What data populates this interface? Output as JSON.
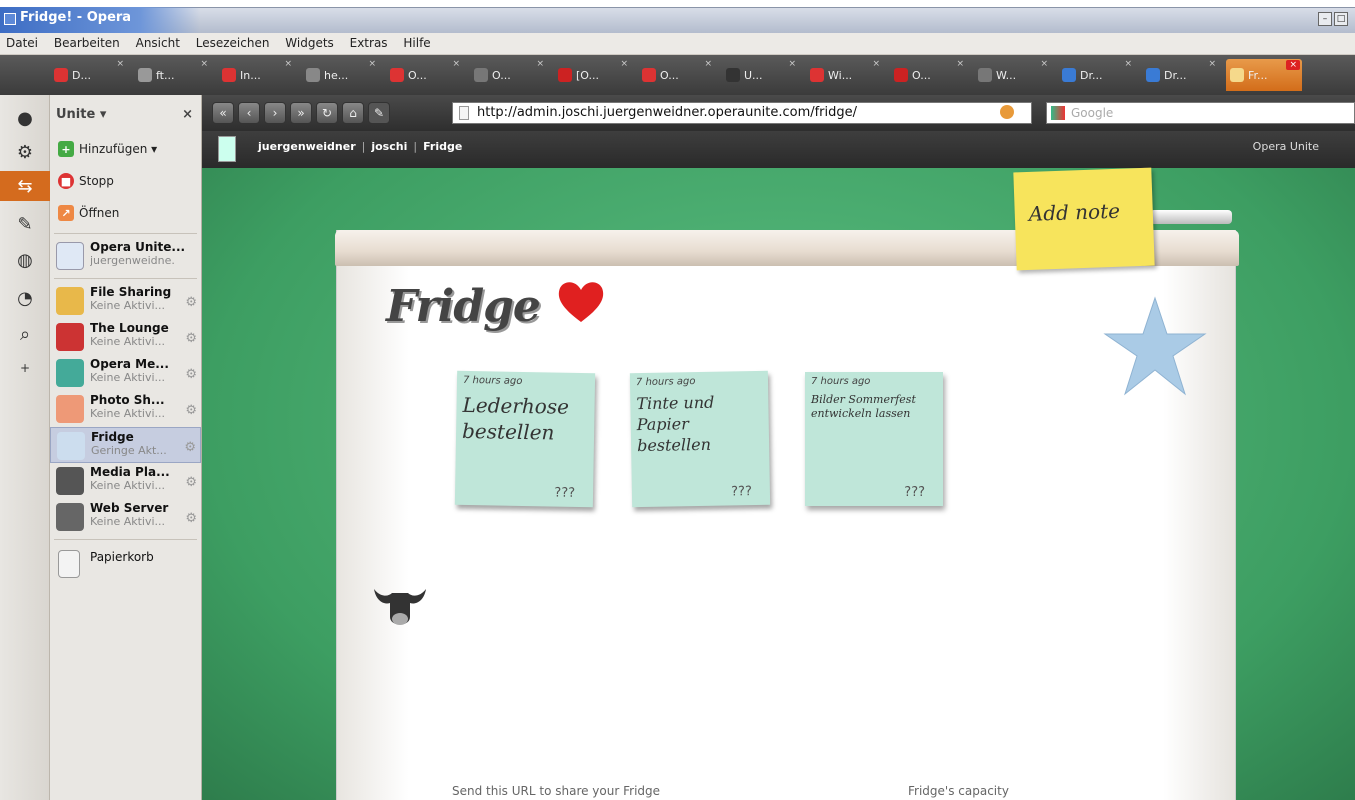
{
  "window": {
    "title": "Fridge! - Opera"
  },
  "menu": [
    "Datei",
    "Bearbeiten",
    "Ansicht",
    "Lesezeichen",
    "Widgets",
    "Extras",
    "Hilfe"
  ],
  "tabs": [
    {
      "label": "D...",
      "color": "#d33"
    },
    {
      "label": "ft...",
      "color": "#999"
    },
    {
      "label": "In...",
      "color": "#d33"
    },
    {
      "label": "he...",
      "color": "#888"
    },
    {
      "label": "O...",
      "color": "#d33"
    },
    {
      "label": "O...",
      "color": "#777"
    },
    {
      "label": "[O...",
      "color": "#c22"
    },
    {
      "label": "O...",
      "color": "#d33"
    },
    {
      "label": "U...",
      "color": "#333"
    },
    {
      "label": "Wi...",
      "color": "#d33"
    },
    {
      "label": "O...",
      "color": "#c22"
    },
    {
      "label": "W...",
      "color": "#777"
    },
    {
      "label": "Dr...",
      "color": "#3a7bd5"
    },
    {
      "label": "Dr...",
      "color": "#3a7bd5"
    },
    {
      "label": "Fr...",
      "color": "#f5d98b",
      "active": true
    }
  ],
  "panel": {
    "title": "Unite ▾",
    "close": "×",
    "actions": [
      {
        "label": "Hinzufügen ▾",
        "color": "#4a4"
      },
      {
        "label": "Stopp",
        "color": "#d33"
      },
      {
        "label": "Öffnen",
        "color": "#e84"
      }
    ],
    "home": {
      "name": "Opera Unite...",
      "status": "juergenweidne..."
    },
    "services": [
      {
        "name": "File Sharing",
        "status": "Keine Aktivi...",
        "color": "#e8b84a"
      },
      {
        "name": "The Lounge",
        "status": "Keine Aktivi...",
        "color": "#c33"
      },
      {
        "name": "Opera Me...",
        "status": "Keine Aktivi...",
        "color": "#4a9"
      },
      {
        "name": "Photo Sh...",
        "status": "Keine Aktivi...",
        "color": "#e97"
      },
      {
        "name": "Fridge",
        "status": "Geringe Akt...",
        "color": "#cde",
        "selected": true
      },
      {
        "name": "Media Pla...",
        "status": "Keine Aktivi...",
        "color": "#555"
      },
      {
        "name": "Web Server",
        "status": "Keine Aktivi...",
        "color": "#666"
      }
    ],
    "trash": "Papierkorb"
  },
  "nav": {
    "url": "http://admin.joschi.juergenweidner.operaunite.com/fridge/",
    "search_placeholder": "Google"
  },
  "site": {
    "user": "juergenweidner",
    "device": "joschi",
    "app": "Fridge",
    "opera_unite": "Opera Unite"
  },
  "fridge": {
    "add_note": "Add note",
    "logo": "Fridge",
    "notes": [
      {
        "time": "7 hours ago",
        "text": "Lederhose bestellen",
        "more": "???"
      },
      {
        "time": "7 hours ago",
        "text": "Tinte und Papier bestellen",
        "more": "???"
      },
      {
        "time": "7 hours ago",
        "text": "Bilder Sommerfest entwickeln lassen",
        "more": "???"
      }
    ],
    "share_text": "Send this URL to share your Fridge",
    "capacity_text": "Fridge's capacity"
  }
}
